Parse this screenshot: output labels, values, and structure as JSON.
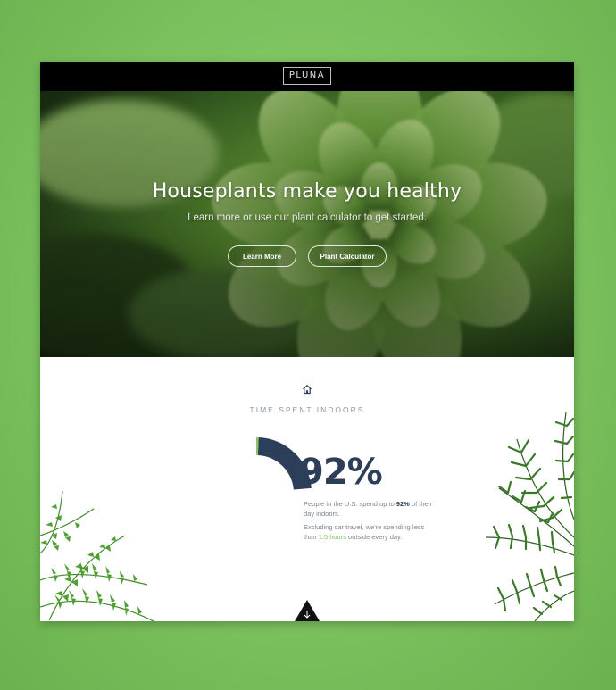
{
  "header": {
    "logo_text": "PLUNA"
  },
  "hero": {
    "title": "Houseplants make you healthy",
    "subtitle": "Learn more or use our plant calculator to get started.",
    "buttons": {
      "learn_more": "Learn More",
      "plant_calculator": "Plant Calculator"
    }
  },
  "stats": {
    "section_icon": "house-icon",
    "section_title": "TIME SPENT INDOORS",
    "percent_text": "92%",
    "percent_value": 92,
    "para1_before": "People in the U.S. spend up to ",
    "para1_highlight": "92%",
    "para1_after": " of their day indoors.",
    "para2_before": "Excluding car travel, we're spending less than ",
    "para2_highlight": "1.5 hours",
    "para2_after": " outside every day."
  },
  "scroll_icon": "arrow-down-icon",
  "colors": {
    "page_background": "#7cc25f",
    "donut_fill": "#2c3e58",
    "donut_accent": "#8cc66a",
    "highlight_green": "#7cc24f",
    "dark_text": "#2c3e58"
  }
}
